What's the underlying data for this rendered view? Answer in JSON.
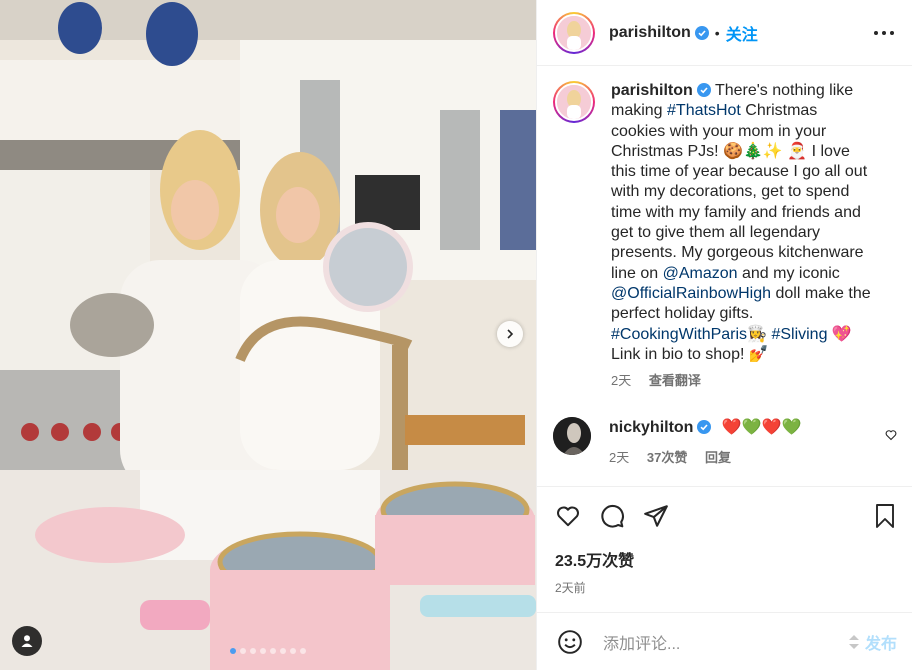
{
  "post": {
    "author": "parishilton",
    "follow_label": "关注",
    "separator": "•"
  },
  "caption": {
    "username": "parishilton",
    "segments": [
      {
        "text": "There's nothing like making ",
        "type": "text"
      },
      {
        "text": "#ThatsHot",
        "type": "link"
      },
      {
        "text": " Christmas cookies with your mom in your Christmas PJs! 🍪🎄✨ 🎅 I love this time of year because I go all out with my decorations, get to spend time with my family and friends and get to give them all legendary presents. My gorgeous kitchenware line on ",
        "type": "text"
      },
      {
        "text": "@Amazon",
        "type": "link"
      },
      {
        "text": " and my iconic ",
        "type": "text"
      },
      {
        "text": "@OfficialRainbowHigh",
        "type": "link"
      },
      {
        "text": " doll make the perfect holiday gifts. ",
        "type": "text"
      },
      {
        "text": "#CookingWithParis",
        "type": "link"
      },
      {
        "text": "👩‍🍳 ",
        "type": "text"
      },
      {
        "text": "#Sliving",
        "type": "link"
      },
      {
        "text": " 💖 Link in bio to shop! 💅",
        "type": "text"
      }
    ],
    "time": "2天",
    "translate_label": "查看翻译"
  },
  "comment": {
    "username": "nickyhilton",
    "text": "❤️💚❤️💚",
    "time": "2天",
    "likes": "37次赞",
    "reply_label": "回复"
  },
  "stats": {
    "likes": "23.5万次赞",
    "posted": "2天前"
  },
  "comment_box": {
    "placeholder": "添加评论...",
    "post_label": "发布"
  },
  "carousel": {
    "slide_count": 8,
    "active_index": 0
  },
  "colors": {
    "accent": "#0095f6",
    "link": "#00376b",
    "muted": "#737373",
    "post_disabled": "#b2dffc"
  },
  "icons": [
    "verified-badge-icon",
    "more-options-icon",
    "heart-icon",
    "comment-icon",
    "share-icon",
    "bookmark-icon",
    "emoji-icon",
    "chevron-right-icon",
    "user-tag-icon"
  ]
}
